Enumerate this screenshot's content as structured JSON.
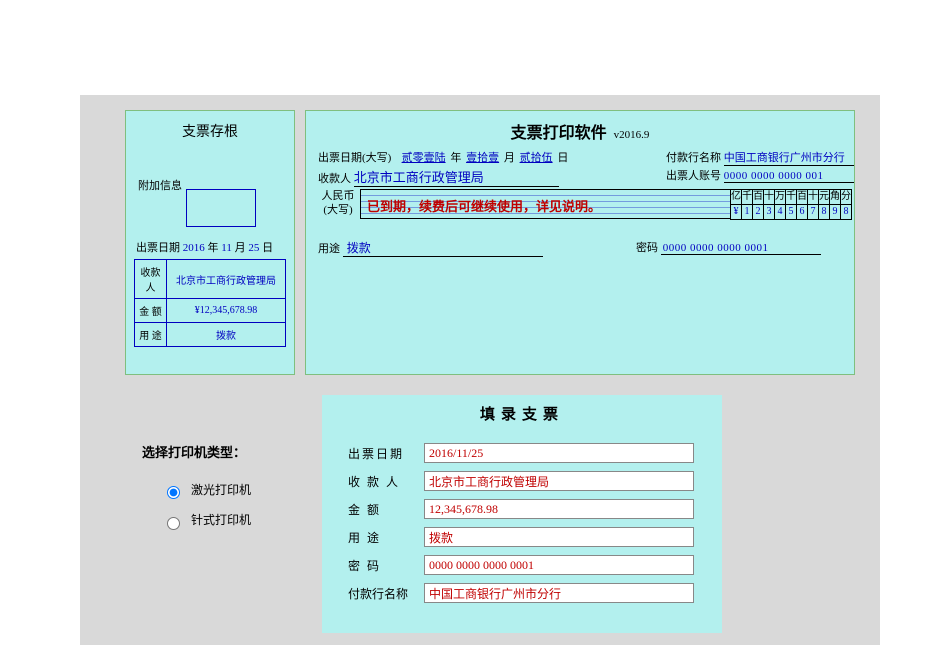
{
  "stub": {
    "title": "支票存根",
    "additional_info_label": "附加信息",
    "date_label": "出票日期",
    "date_year": "2016",
    "date_year_unit": "年",
    "date_month": "11",
    "date_month_unit": "月",
    "date_day": "25",
    "date_day_unit": "日",
    "payee_label": "收款人",
    "payee_value": "北京市工商行政管理局",
    "amount_label": "金 额",
    "amount_value": "¥12,345,678.98",
    "use_label": "用 途",
    "use_value": "拨款"
  },
  "cheque": {
    "title": "支票打印软件",
    "version": "v2016.9",
    "date_label": "出票日期(大写)",
    "date_year_cn": "贰零壹陆",
    "year_unit": "年",
    "date_month_cn": "壹拾壹",
    "month_unit": "月",
    "date_day_cn": "贰拾伍",
    "day_unit": "日",
    "payee_label": "收款人",
    "payee_value": "北京市工商行政管理局",
    "bank_label": "付款行名称",
    "bank_value": "中国工商银行广州市分行",
    "acct_label": "出票人账号",
    "acct_value": "0000 0000 0000 001",
    "rmb_label_line1": "人民币",
    "rmb_label_line2": "(大写)",
    "expired_notice": "已到期，续费后可继续使用，详见说明。",
    "digit_headers": [
      "亿",
      "千",
      "百",
      "十",
      "万",
      "千",
      "百",
      "十",
      "元",
      "角",
      "分"
    ],
    "digit_values": [
      "¥",
      "1",
      "2",
      "3",
      "4",
      "5",
      "6",
      "7",
      "8",
      "9",
      "8"
    ],
    "use_label": "用途",
    "use_value": "拨款",
    "pwd_label": "密码",
    "pwd_value": "0000 0000 0000 0001"
  },
  "fill": {
    "title": "填录支票",
    "rows": {
      "date": {
        "label": "出票日期",
        "value": "2016/11/25"
      },
      "payee": {
        "label": "收 款 人",
        "value": "北京市工商行政管理局"
      },
      "amount": {
        "label": "金    额",
        "value": "12,345,678.98"
      },
      "use": {
        "label": "用    途",
        "value": "拨款"
      },
      "pwd": {
        "label": "密    码",
        "value": "0000 0000 0000 0001"
      },
      "bank": {
        "label": "付款行名称",
        "value": "中国工商银行广州市分行"
      }
    }
  },
  "printer": {
    "title": "选择打印机类型：",
    "option_laser": "激光打印机",
    "option_dot": "针式打印机",
    "selected": "laser"
  }
}
